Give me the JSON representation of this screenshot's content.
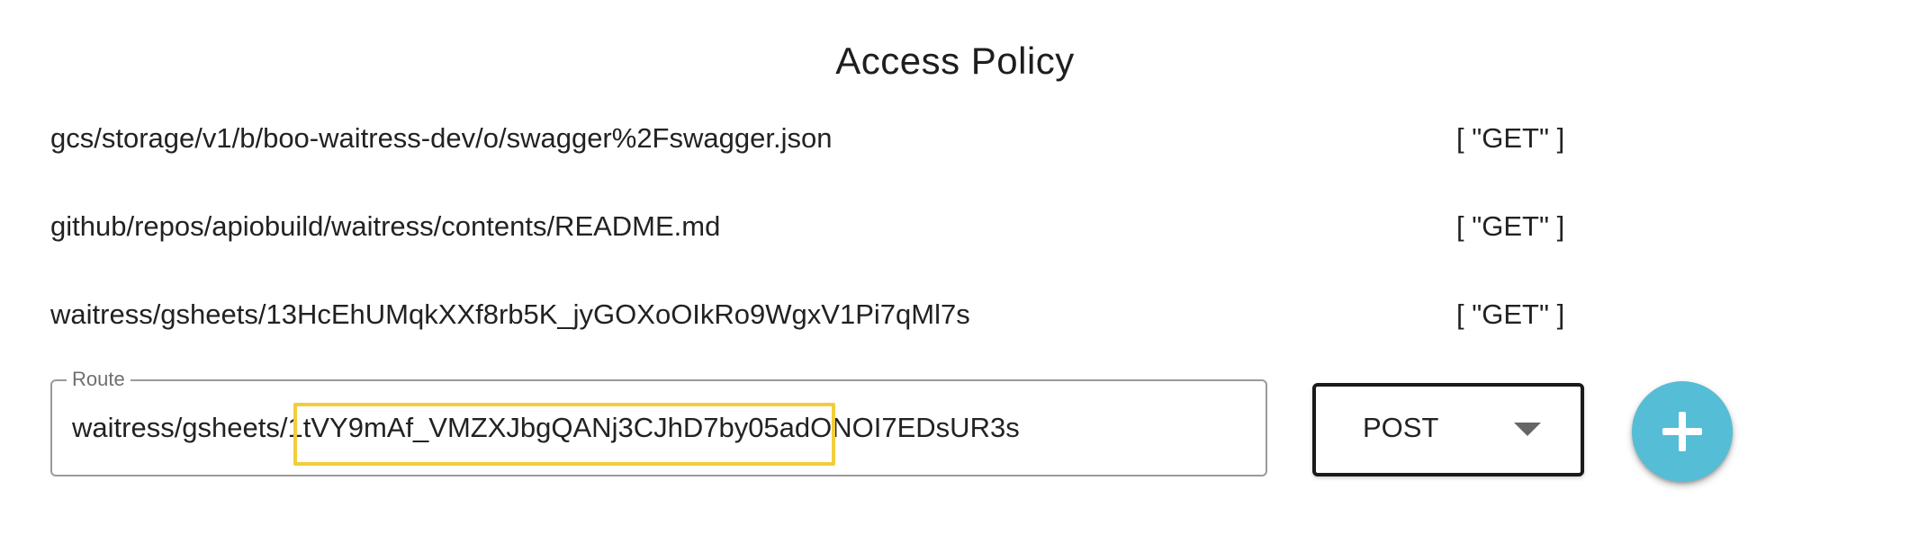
{
  "header": {
    "title": "Access Policy"
  },
  "policies": [
    {
      "route": "gcs/storage/v1/b/boo-waitress-dev/o/swagger%2Fswagger.json",
      "methods": "[ \"GET\" ]"
    },
    {
      "route": "github/repos/apiobuild/waitress/contents/README.md",
      "methods": "[ \"GET\" ]"
    },
    {
      "route": "waitress/gsheets/13HcEhUMqkXXf8rb5K_jyGOXoOIkRo9WgxV1Pi7qMl7s",
      "methods": "[ \"GET\" ]"
    }
  ],
  "new_policy": {
    "route_label": "Route",
    "route_value": "waitress/gsheets/1tVY9mAf_VMZXJbgQANj3CJhD7by05adONOI7EDsUR3s",
    "method_value": "POST",
    "add_button_icon": "plus-icon"
  },
  "colors": {
    "highlight": "#f2cd3c",
    "fab": "#55bdd6"
  }
}
